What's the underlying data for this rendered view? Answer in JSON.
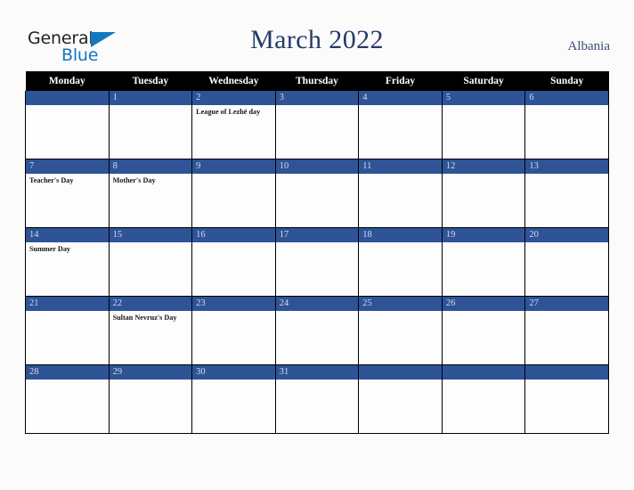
{
  "brand": {
    "word_one": "General",
    "word_two": "Blue",
    "triangle_icon": "triangle-icon",
    "color_dark": "#231f20",
    "color_blue": "#1378be"
  },
  "header": {
    "title": "March 2022",
    "country": "Albania",
    "title_color": "#253a66"
  },
  "calendar": {
    "weekday_headers": [
      "Monday",
      "Tuesday",
      "Wednesday",
      "Thursday",
      "Friday",
      "Saturday",
      "Sunday"
    ],
    "header_bg": "#000000",
    "daynum_bg": "#2e5396",
    "daynum_color": "#d7dcea",
    "weeks": [
      [
        {
          "day": "",
          "events": []
        },
        {
          "day": "1",
          "events": []
        },
        {
          "day": "2",
          "events": [
            "League of Lezhë day"
          ]
        },
        {
          "day": "3",
          "events": []
        },
        {
          "day": "4",
          "events": []
        },
        {
          "day": "5",
          "events": []
        },
        {
          "day": "6",
          "events": []
        }
      ],
      [
        {
          "day": "7",
          "events": [
            "Teacher's Day"
          ]
        },
        {
          "day": "8",
          "events": [
            "Mother's Day"
          ]
        },
        {
          "day": "9",
          "events": []
        },
        {
          "day": "10",
          "events": []
        },
        {
          "day": "11",
          "events": []
        },
        {
          "day": "12",
          "events": []
        },
        {
          "day": "13",
          "events": []
        }
      ],
      [
        {
          "day": "14",
          "events": [
            "Summer Day"
          ]
        },
        {
          "day": "15",
          "events": []
        },
        {
          "day": "16",
          "events": []
        },
        {
          "day": "17",
          "events": []
        },
        {
          "day": "18",
          "events": []
        },
        {
          "day": "19",
          "events": []
        },
        {
          "day": "20",
          "events": []
        }
      ],
      [
        {
          "day": "21",
          "events": []
        },
        {
          "day": "22",
          "events": [
            "Sultan Nevruz's Day"
          ]
        },
        {
          "day": "23",
          "events": []
        },
        {
          "day": "24",
          "events": []
        },
        {
          "day": "25",
          "events": []
        },
        {
          "day": "26",
          "events": []
        },
        {
          "day": "27",
          "events": []
        }
      ],
      [
        {
          "day": "28",
          "events": []
        },
        {
          "day": "29",
          "events": []
        },
        {
          "day": "30",
          "events": []
        },
        {
          "day": "31",
          "events": []
        },
        {
          "day": "",
          "events": []
        },
        {
          "day": "",
          "events": []
        },
        {
          "day": "",
          "events": []
        }
      ]
    ]
  }
}
